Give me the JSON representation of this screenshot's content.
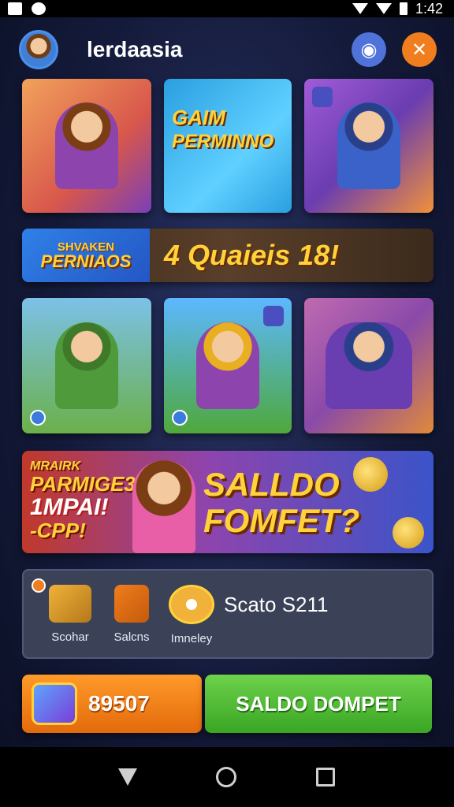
{
  "status_bar": {
    "time": "1:42",
    "icons": [
      "notification-icon",
      "app-icon",
      "wifi-icon",
      "signal-icon",
      "battery-icon"
    ]
  },
  "header": {
    "title": "lerdaasia",
    "avatar": "avatar",
    "buttons": [
      "discord-icon",
      "close-icon"
    ]
  },
  "tiles_row1": [
    {
      "name": "tile-1",
      "colors": [
        "#f2a25b",
        "#7a3fb8"
      ]
    },
    {
      "name": "tile-2",
      "label_top": "GAIM",
      "label_mid": "PERMINNO",
      "colors": [
        "#2a9fe0",
        "#5fd0ff"
      ]
    },
    {
      "name": "tile-3",
      "colors": [
        "#a25bd8",
        "#f0913a"
      ]
    }
  ],
  "banner1": {
    "left_line1": "SHVAKEN",
    "left_line2": "PERNIAOS",
    "text": "4 Quaieis 18!"
  },
  "tiles_row2": [
    {
      "name": "tile-4",
      "colors": [
        "#7cc1e8",
        "#6bb04a"
      ]
    },
    {
      "name": "tile-5",
      "colors": [
        "#5cb8ff",
        "#4fa83c"
      ]
    },
    {
      "name": "tile-6",
      "colors": [
        "#c06ab0",
        "#e08a3a"
      ]
    }
  ],
  "banner2": {
    "left_line1": "MRAIRK",
    "left_line2": "PARMIGE3",
    "left_line3": "1MPAI!",
    "left_line4": "-CPP!",
    "right_line1": "SALLDO",
    "right_line2": "FOMFET?"
  },
  "panel": {
    "items": [
      {
        "label": "Scohar",
        "icon": "chest-icon",
        "color": "#f0b23a"
      },
      {
        "label": "Salcns",
        "icon": "shield-icon",
        "color": "#f07d1e"
      },
      {
        "label": "Imneley",
        "icon": "coin-icon",
        "color": "#f0b23a"
      }
    ],
    "value": "Scato S211"
  },
  "bottom": {
    "orange_value": "89507",
    "green_label": "SALDO DOMPET"
  },
  "nav": [
    "back-icon",
    "home-icon",
    "recent-apps-icon"
  ]
}
